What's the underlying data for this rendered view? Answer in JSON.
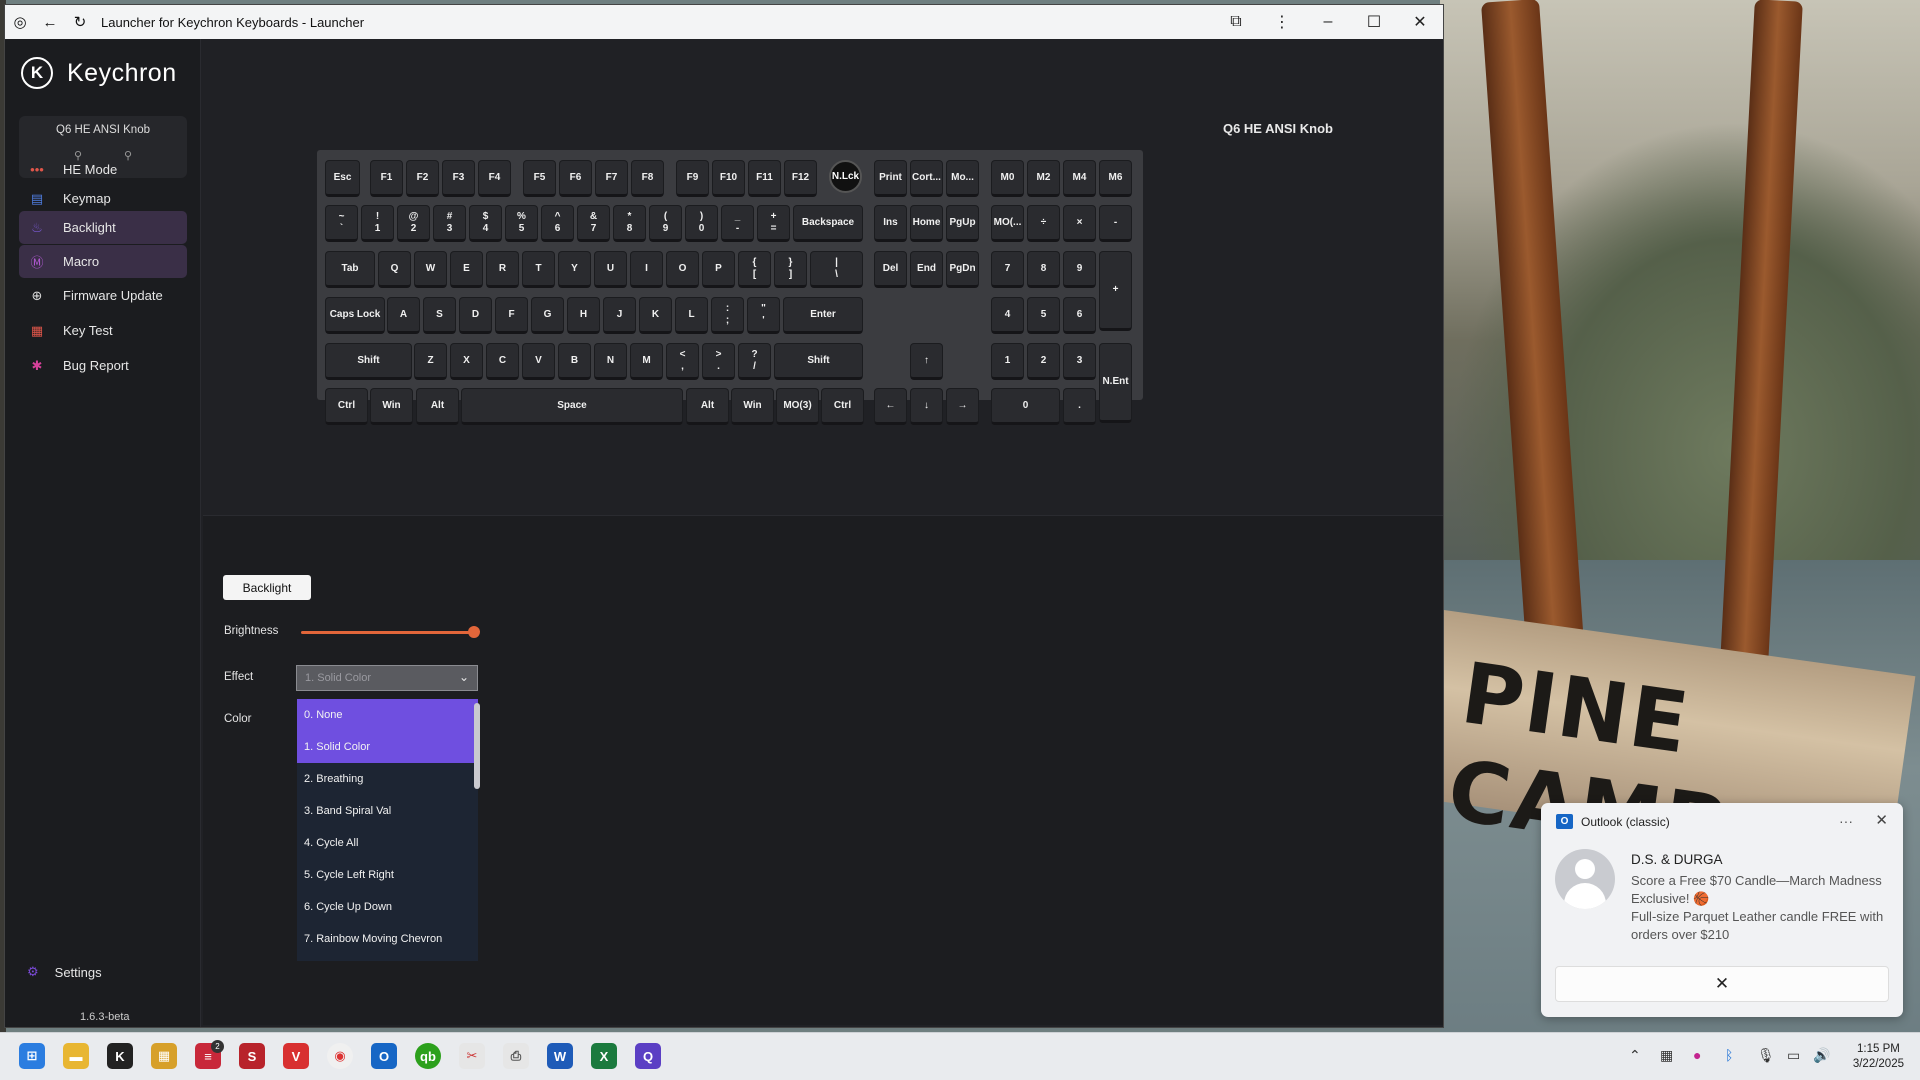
{
  "window": {
    "title": "Launcher for Keychron Keyboards - Launcher"
  },
  "sidebar": {
    "brand": "Keychron",
    "device_name": "Q6 HE ANSI Knob",
    "items": [
      {
        "label": "HE Mode"
      },
      {
        "label": "Keymap"
      },
      {
        "label": "Backlight"
      },
      {
        "label": "Macro"
      },
      {
        "label": "Firmware Update"
      },
      {
        "label": "Key Test"
      },
      {
        "label": "Bug Report"
      }
    ],
    "settings_label": "Settings",
    "version": "1.6.3-beta"
  },
  "keyboard": {
    "title": "Q6 HE ANSI Knob",
    "keys": {
      "esc": "Esc",
      "f1": "F1",
      "f2": "F2",
      "f3": "F3",
      "f4": "F4",
      "f5": "F5",
      "f6": "F6",
      "f7": "F7",
      "f8": "F8",
      "f9": "F9",
      "f10": "F10",
      "f11": "F11",
      "f12": "F12",
      "nlck": "N.Lck",
      "print": "Print",
      "cort": "Cort...",
      "mo": "Mo...",
      "m0": "M0",
      "m2": "M2",
      "m4": "M4",
      "m6": "M6",
      "tilde": "~\n`",
      "n1": "!\n1",
      "n2": "@\n2",
      "n3": "#\n3",
      "n4": "$\n4",
      "n5": "%\n5",
      "n6": "^\n6",
      "n7": "&\n7",
      "n8": "*\n8",
      "n9": "(\n9",
      "n0": ")\n0",
      "minus": "_\n-",
      "plus": "+\n=",
      "bksp": "Backspace",
      "ins": "Ins",
      "home": "Home",
      "pgup": "PgUp",
      "mo2": "MO(...",
      "div": "÷",
      "mul": "×",
      "sub": "-",
      "tab": "Tab",
      "q": "Q",
      "w": "W",
      "e": "E",
      "r": "R",
      "t": "T",
      "y": "Y",
      "u": "U",
      "i": "I",
      "o": "O",
      "p": "P",
      "lbr": "{\n[",
      "rbr": "}\n]",
      "pipe": "|\n\\",
      "del": "Del",
      "end": "End",
      "pgdn": "PgDn",
      "k7": "7",
      "k8": "8",
      "k9": "9",
      "kplus": "+",
      "caps": "Caps Lock",
      "a": "A",
      "s": "S",
      "d": "D",
      "f": "F",
      "g": "G",
      "h": "H",
      "j": "J",
      "k": "K",
      "l": "L",
      "semi": ":\n;",
      "quote": "\"\n'",
      "enter": "Enter",
      "k4": "4",
      "k5": "5",
      "k6": "6",
      "lshift": "Shift",
      "z": "Z",
      "x": "X",
      "c": "C",
      "v": "V",
      "b": "B",
      "n": "N",
      "m": "M",
      "comma": "<\n,",
      "dot": ">\n.",
      "slash": "?\n/",
      "rshift": "Shift",
      "up": "↑",
      "k1": "1",
      "k2": "2",
      "k3": "3",
      "nent": "N.Ent",
      "lctrl": "Ctrl",
      "lwin": "Win",
      "lalt": "Alt",
      "space": "Space",
      "ralt": "Alt",
      "rwin": "Win",
      "mo3": "MO(3)",
      "rctrl": "Ctrl",
      "left": "←",
      "down": "↓",
      "right": "→",
      "k0": "0",
      "kdot": "."
    }
  },
  "panel": {
    "tab_label": "Backlight",
    "brightness_label": "Brightness",
    "brightness_value": 1.0,
    "effect_label": "Effect",
    "effect_value": "1. Solid Color",
    "color_label": "Color",
    "effect_options": [
      "0. None",
      "1. Solid Color",
      "2. Breathing",
      "3. Band Spiral Val",
      "4. Cycle All",
      "5. Cycle Left Right",
      "6. Cycle Up Down",
      "7. Rainbow Moving Chevron"
    ]
  },
  "notification": {
    "app": "Outlook (classic)",
    "sender": "D.S. & DURGA",
    "subject": "Score a Free $70 Candle—March Madness Exclusive! 🏀",
    "body": "Full-size Parquet Leather candle FREE with orders over $210"
  },
  "background": {
    "sign_text": "PINE CAMP"
  },
  "taskbar": {
    "time": "1:15 PM",
    "date": "3/22/2025",
    "badge_count": "2"
  },
  "colors": {
    "accent": "#6f4fe0",
    "slider": "#e2663a",
    "active_nav": "#3a2f47"
  }
}
